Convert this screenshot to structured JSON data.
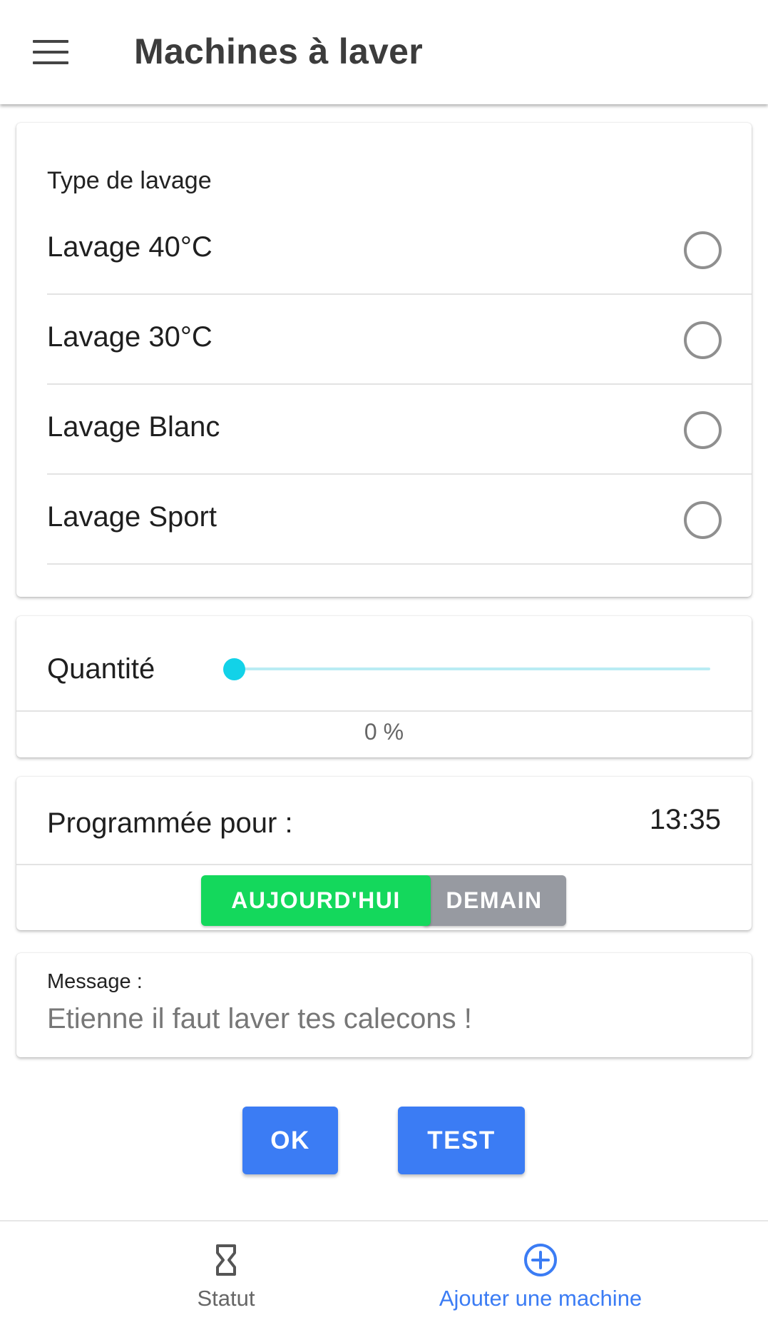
{
  "header": {
    "title": "Machines à laver"
  },
  "wash_type": {
    "label": "Type de lavage",
    "options": [
      {
        "label": "Lavage 40°C",
        "selected": false
      },
      {
        "label": "Lavage 30°C",
        "selected": false
      },
      {
        "label": "Lavage Blanc",
        "selected": false
      },
      {
        "label": "Lavage Sport",
        "selected": false
      }
    ]
  },
  "quantity": {
    "label": "Quantité",
    "value": 0,
    "value_text": "0 %",
    "accent_color": "#12d2e8"
  },
  "schedule": {
    "label": "Programmée pour :",
    "time": "13:35",
    "today_label": "AUJOURD'HUI",
    "tomorrow_label": "DEMAIN",
    "today_color": "#14d85c",
    "tomorrow_color": "#979aa1"
  },
  "message": {
    "label": "Message :",
    "value": "Etienne il faut laver tes calecons !"
  },
  "actions": {
    "ok_label": "OK",
    "test_label": "TEST",
    "color": "#3b7cf4"
  },
  "bottom_nav": {
    "items": [
      {
        "label": "Statut",
        "icon": "hourglass-icon",
        "active": false
      },
      {
        "label": "Ajouter une machine",
        "icon": "add-circle-icon",
        "active": true
      }
    ]
  }
}
